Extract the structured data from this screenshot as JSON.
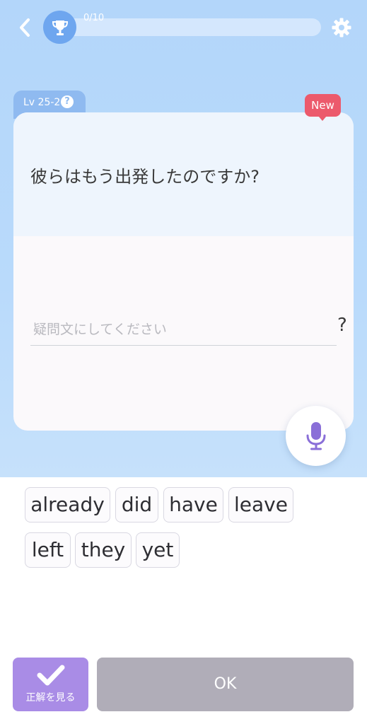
{
  "header": {
    "progress_text": "0/10",
    "progress_fraction": 0,
    "icons": {
      "back": "chevron-left-icon",
      "trophy": "trophy-icon",
      "settings": "gear-icon"
    }
  },
  "level": {
    "label": "Lv 25-2",
    "help_symbol": "?"
  },
  "badge": {
    "label": "New"
  },
  "question": {
    "text": "彼らはもう出発したのですか?"
  },
  "answer": {
    "placeholder": "疑問文にしてください",
    "end_punct": "?"
  },
  "mic": {
    "icon": "microphone-icon"
  },
  "word_bank": [
    "already",
    "did",
    "have",
    "leave",
    "left",
    "they",
    "yet"
  ],
  "buttons": {
    "show_answer_label": "正解を見る",
    "show_answer_icon": "checkmark-icon",
    "ok_label": "OK"
  },
  "colors": {
    "top_background": "#b3d6fa",
    "accent_purple": "#a98ce6",
    "new_badge": "#ec5a6c",
    "ok_disabled": "#b0adb8",
    "mic": "#8a6fd8"
  }
}
